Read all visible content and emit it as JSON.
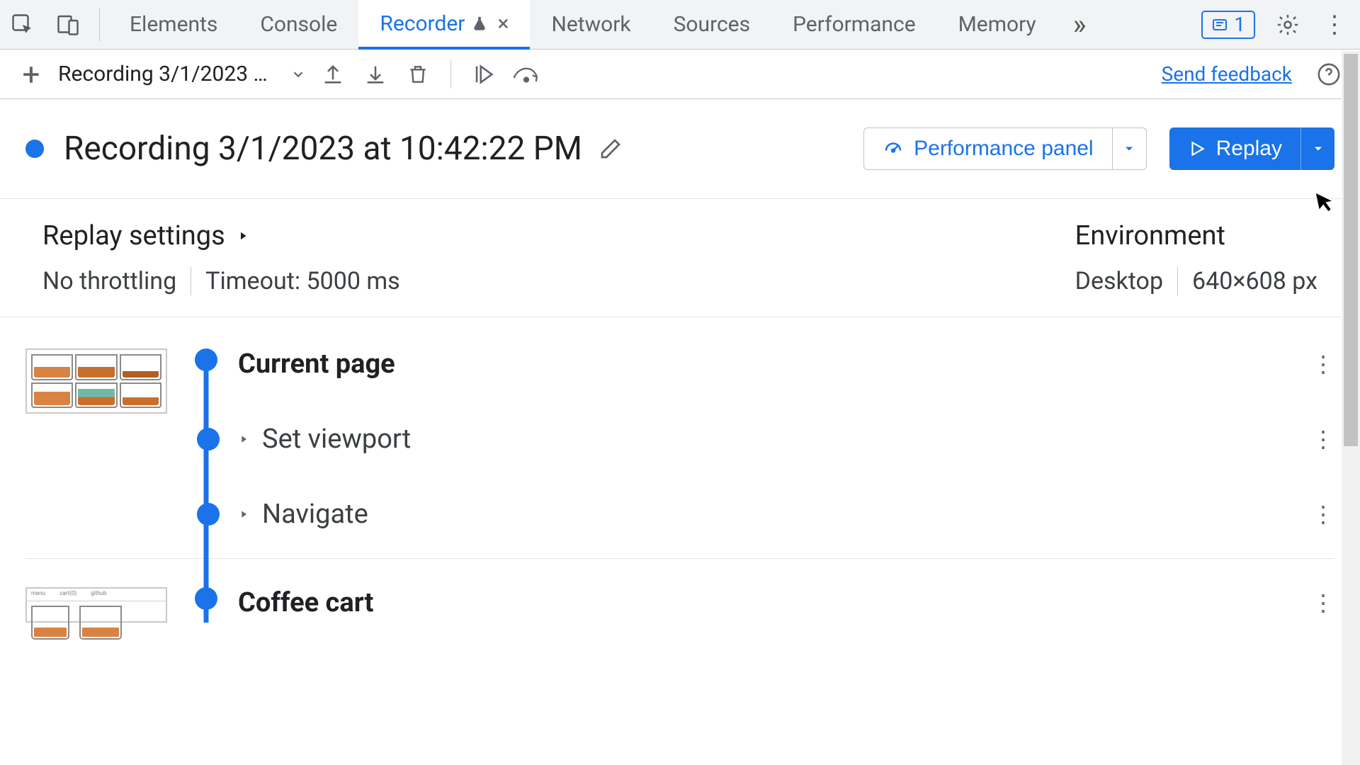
{
  "tabs": {
    "items": [
      "Elements",
      "Console",
      "Recorder",
      "Network",
      "Sources",
      "Performance",
      "Memory"
    ],
    "active_index": 2
  },
  "issues_count": "1",
  "toolbar": {
    "recording_select_label": "Recording 3/1/2023 at 10…",
    "feedback": "Send feedback"
  },
  "recording": {
    "title": "Recording 3/1/2023 at 10:42:22 PM"
  },
  "header_buttons": {
    "performance": "Performance panel",
    "replay": "Replay"
  },
  "settings": {
    "title": "Replay settings",
    "throttling": "No throttling",
    "timeout": "Timeout: 5000 ms"
  },
  "environment": {
    "title": "Environment",
    "device": "Desktop",
    "viewport": "640×608 px"
  },
  "steps": {
    "group1": {
      "title": "Current page",
      "sub1": "Set viewport",
      "sub2": "Navigate"
    },
    "group2": {
      "title": "Coffee cart"
    }
  }
}
